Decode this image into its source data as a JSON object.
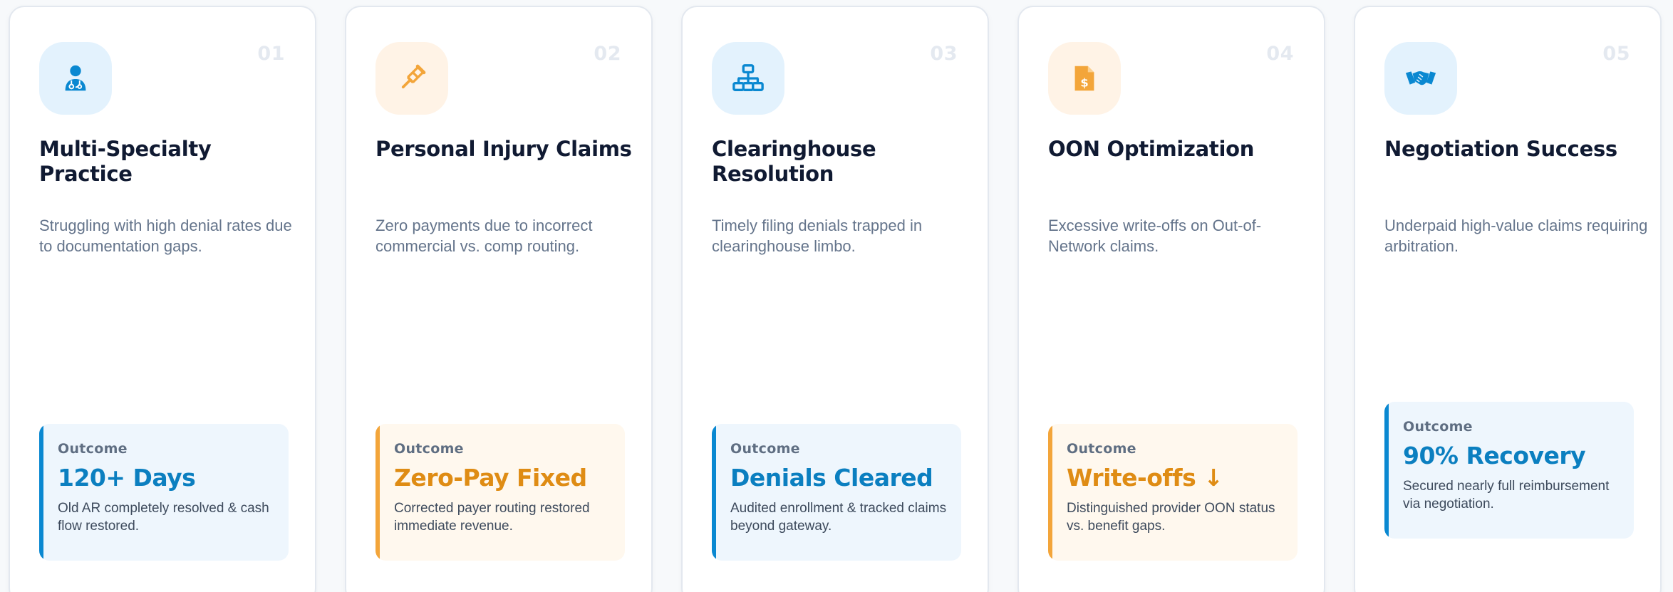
{
  "outcome_label": "Outcome",
  "colors": {
    "blue_accent": "#0a88d1",
    "orange_accent": "#f3a53a",
    "title": "#101a32",
    "muted": "#64748b"
  },
  "cards": [
    {
      "number": "01",
      "icon": "doctor-icon",
      "title": "Multi-Specialty Practice",
      "description": "Struggling with high denial rates due to documentation gaps.",
      "outcome_value": "120+ Days",
      "outcome_note": "Old AR completely resolved & cash flow restored."
    },
    {
      "number": "02",
      "icon": "crutch-icon",
      "title": "Personal Injury Claims",
      "description": "Zero payments due to incorrect commercial vs. comp routing.",
      "outcome_value": "Zero-Pay Fixed",
      "outcome_note": "Corrected payer routing restored immediate revenue."
    },
    {
      "number": "03",
      "icon": "network-icon",
      "title": "Clearinghouse Resolution",
      "description": "Timely filing denials trapped in clearinghouse limbo.",
      "outcome_value": "Denials Cleared",
      "outcome_note": "Audited enrollment & tracked claims beyond gateway."
    },
    {
      "number": "04",
      "icon": "invoice-dollar-icon",
      "title": "OON Optimization",
      "description": "Excessive write-offs on Out-of-Network claims.",
      "outcome_value": "Write-offs ↓",
      "outcome_note": "Distinguished provider OON status vs. benefit gaps."
    },
    {
      "number": "05",
      "icon": "handshake-icon",
      "title": "Negotiation Success",
      "description": "Underpaid high-value claims requiring arbitration.",
      "outcome_value": "90% Recovery",
      "outcome_note": "Secured nearly full reimbursement via negotiation."
    }
  ]
}
